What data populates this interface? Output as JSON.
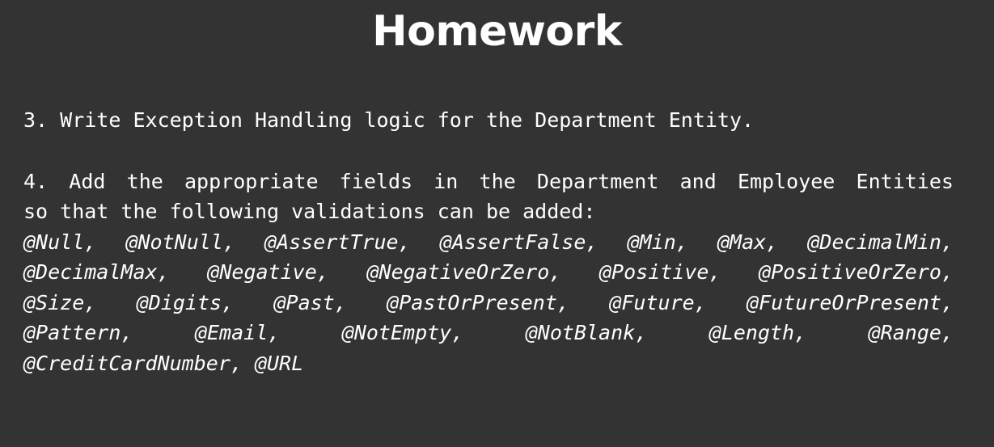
{
  "title": "Homework",
  "item3": "3. Write Exception Handling logic for the Department Entity.",
  "item4_words": [
    "4.",
    "Add",
    "the",
    "appropriate",
    "fields",
    "in",
    "the",
    "Department",
    "and",
    "Employee",
    "Entities"
  ],
  "item4_line2": "so that the following validations can be added:",
  "annotation_lines": [
    [
      "@Null,",
      "@NotNull,",
      "@AssertTrue,",
      "@AssertFalse,",
      "@Min,",
      "@Max,",
      "@DecimalMin,"
    ],
    [
      "@DecimalMax,",
      "@Negative,",
      "@NegativeOrZero,",
      "@Positive,",
      "@PositiveOrZero,"
    ],
    [
      "@Size,",
      "@Digits,",
      "@Past,",
      "@PastOrPresent,",
      "@Future,",
      "@FutureOrPresent,"
    ],
    [
      "@Pattern,",
      "@Email,",
      "@NotEmpty,",
      "@NotBlank,",
      "@Length,",
      "@Range,"
    ],
    [
      "@CreditCardNumber,",
      "@URL"
    ]
  ]
}
